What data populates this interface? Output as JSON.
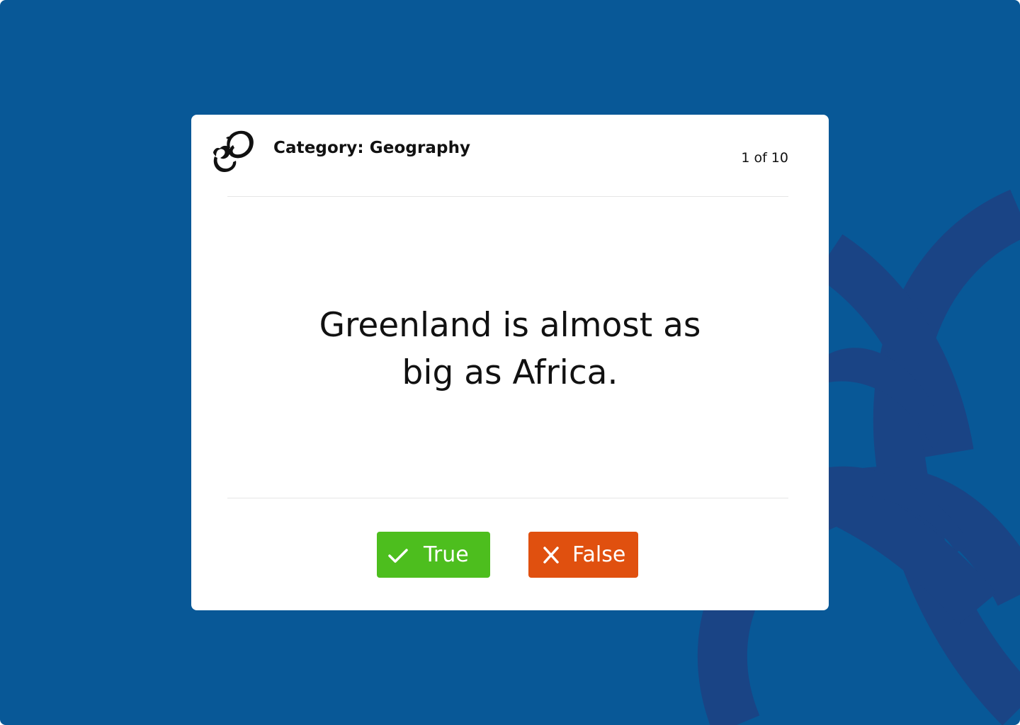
{
  "quiz": {
    "category_label": "Category: Geography",
    "progress_text": "1 of 10",
    "question": "Greenland is almost as big as Africa.",
    "true_label": "True",
    "false_label": "False"
  },
  "icons": {
    "logo": "brand-logo-icon",
    "true": "check-icon",
    "false": "close-icon"
  },
  "colors": {
    "background": "#085897",
    "card": "#ffffff",
    "true_button": "#4dbe1e",
    "false_button": "#e0500f"
  }
}
